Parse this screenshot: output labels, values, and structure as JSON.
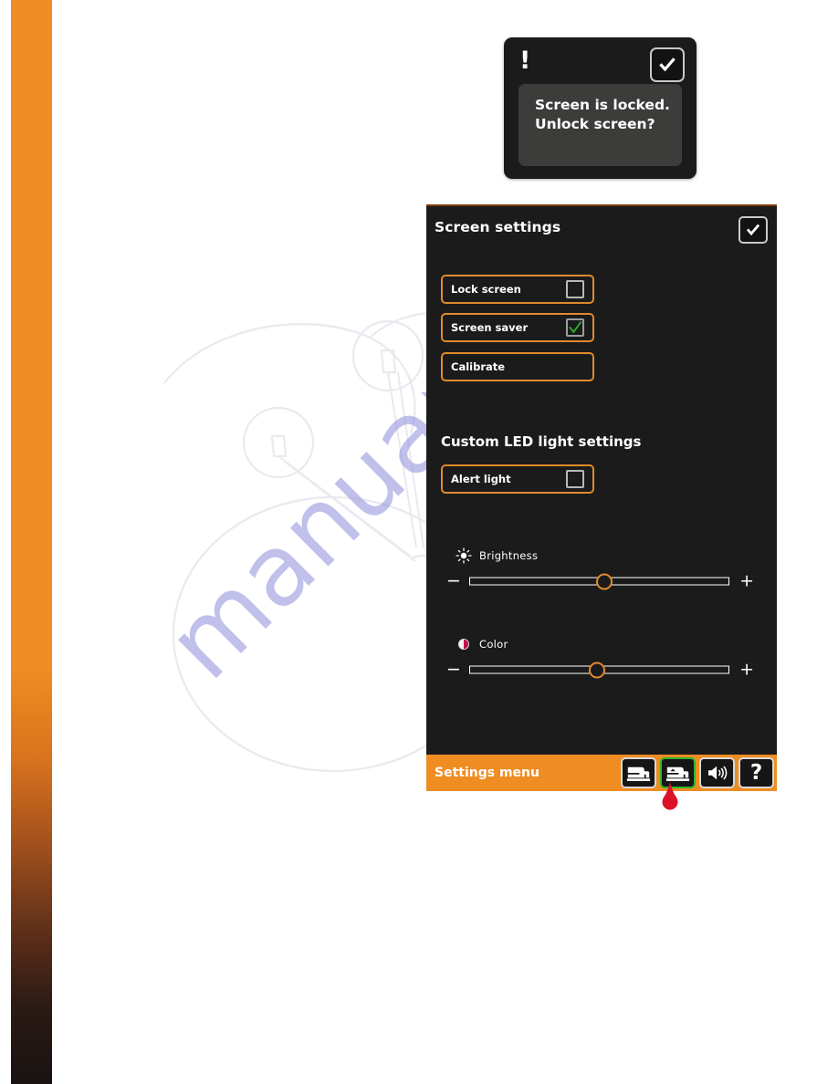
{
  "page": {
    "background_color": "#ffffff",
    "brand_strip": {
      "name": "orange-gradient-strip",
      "top_color": "#ef8c22",
      "bottom_color": "#191312"
    },
    "watermark": {
      "text": "manualshive.com",
      "color": "#9a9ae0"
    }
  },
  "lock_dialog": {
    "alert_glyph": "!",
    "message_line1": "Screen is locked.",
    "message_line2": "Unlock screen?",
    "ok_icon": "checkmark-icon",
    "background_color": "#1b1b1b",
    "body_color": "#3c3c3b"
  },
  "settings_panel": {
    "title": "Screen settings",
    "ok_icon": "checkmark-icon",
    "accent_color": "#e08a2e",
    "background_color": "#1b1b1b",
    "options": [
      {
        "label": "Lock screen",
        "checked": false,
        "has_checkbox": true
      },
      {
        "label": "Screen saver",
        "checked": true,
        "has_checkbox": true
      },
      {
        "label": "Calibrate",
        "checked": false,
        "has_checkbox": false
      }
    ],
    "led_section": {
      "heading": "Custom LED light settings",
      "option": {
        "label": "Alert light",
        "checked": false,
        "has_checkbox": true
      }
    },
    "sliders": [
      {
        "label": "Brightness",
        "icon": "sun-brightness-icon",
        "minus": "−",
        "plus": "+",
        "value_percent": 52
      },
      {
        "label": "Color",
        "icon": "half-filled-circle-icon",
        "minus": "−",
        "plus": "+",
        "value_percent": 49
      }
    ],
    "bottom_bar": {
      "label": "Settings menu",
      "background_color": "#ef8c22",
      "buttons": [
        {
          "name": "machine-settings-button",
          "icon": "sewing-machine-icon",
          "selected": false,
          "glyph": ""
        },
        {
          "name": "screen-settings-button",
          "icon": "sewing-machine-screen-icon",
          "selected": true,
          "glyph": ""
        },
        {
          "name": "sound-settings-button",
          "icon": "speaker-icon",
          "selected": false,
          "glyph": ""
        },
        {
          "name": "help-button",
          "icon": "question-mark-icon",
          "selected": false,
          "glyph": "?"
        }
      ],
      "selected_marker": {
        "name": "red-drop-marker",
        "color": "#dd1228"
      }
    }
  }
}
